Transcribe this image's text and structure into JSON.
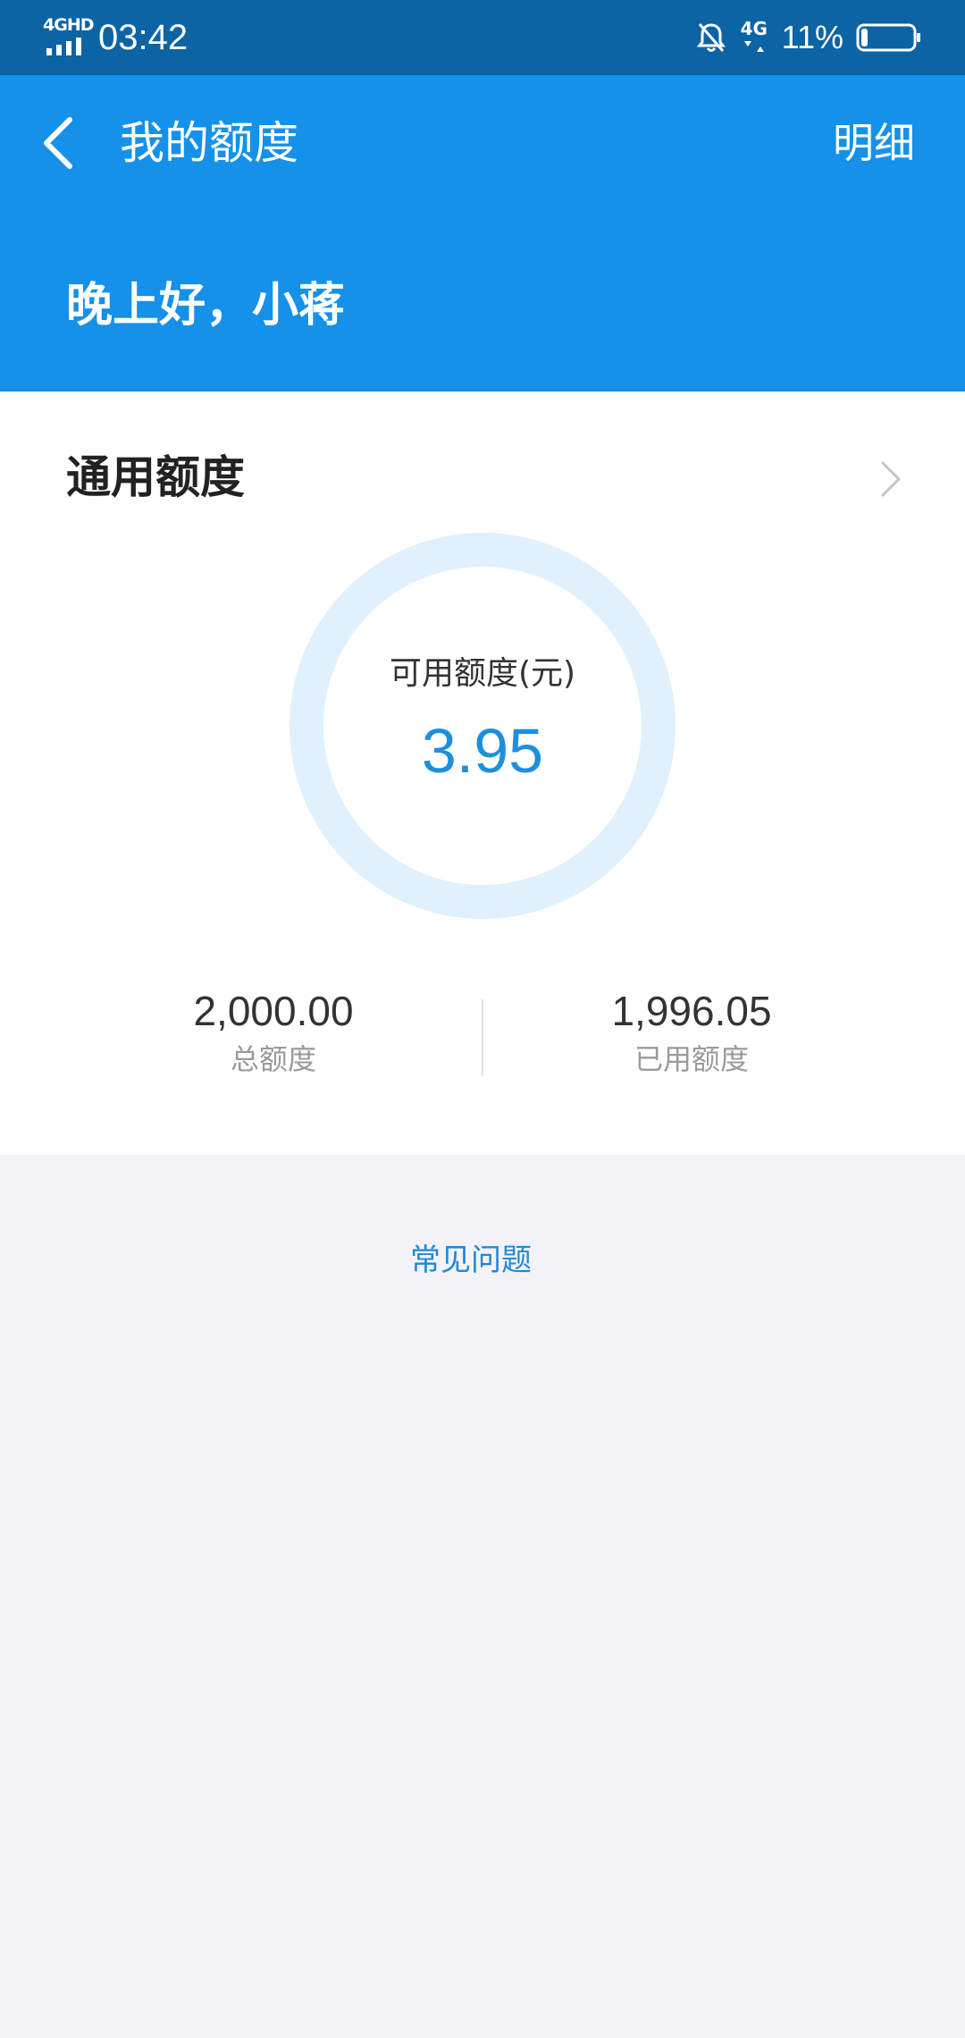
{
  "status_bar": {
    "network_label": "4GHD",
    "time": "03:42",
    "data_label": "4G",
    "battery_percent": "11%",
    "battery_level": 0.11,
    "icons": [
      "signal-icon",
      "bell-off-icon",
      "mobile-data-icon",
      "battery-icon"
    ]
  },
  "header": {
    "back_icon": "chevron-left-icon",
    "title": "我的额度",
    "detail_label": "明细",
    "greeting": "晚上好，小蒋"
  },
  "quota": {
    "section_title": "通用额度",
    "chevron_icon": "chevron-right-icon",
    "available_label": "可用额度(元)",
    "available_value": "3.95",
    "total_value": "2,000.00",
    "total_label": "总额度",
    "used_value": "1,996.05",
    "used_label": "已用额度"
  },
  "faq": {
    "label": "常见问题"
  },
  "colors": {
    "status_bar": "#0c64a5",
    "header": "#1591ea",
    "ring": "#e0f1fd",
    "accent": "#1e8fde",
    "page_bg": "#f3f3f7"
  }
}
